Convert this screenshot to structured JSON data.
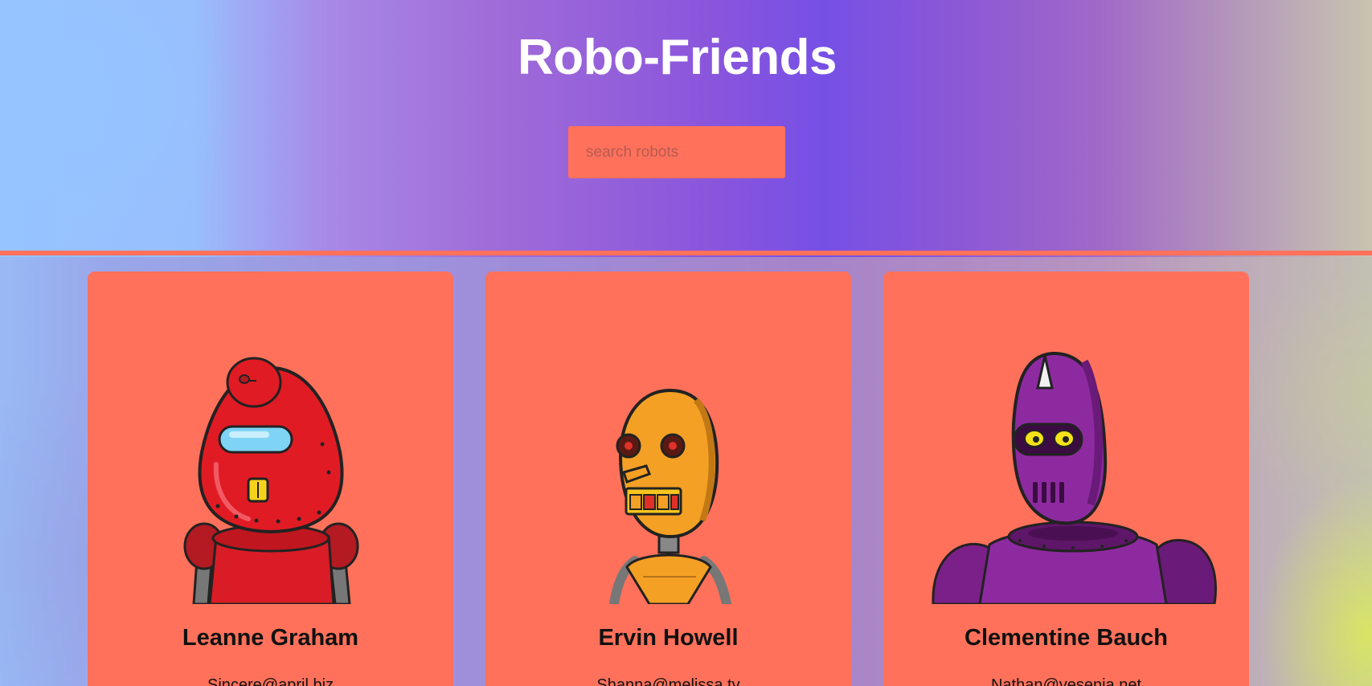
{
  "header": {
    "title": "Robo-Friends",
    "search_placeholder": "search robots",
    "search_value": ""
  },
  "colors": {
    "accent": "#ff715b",
    "title_text": "#ffffff"
  },
  "robots": [
    {
      "name": "Leanne Graham",
      "email": "Sincere@april.biz",
      "avatar": "red-robot-avatar"
    },
    {
      "name": "Ervin Howell",
      "email": "Shanna@melissa.tv",
      "avatar": "orange-robot-avatar"
    },
    {
      "name": "Clementine Bauch",
      "email": "Nathan@yesenia.net",
      "avatar": "purple-robot-avatar"
    }
  ]
}
